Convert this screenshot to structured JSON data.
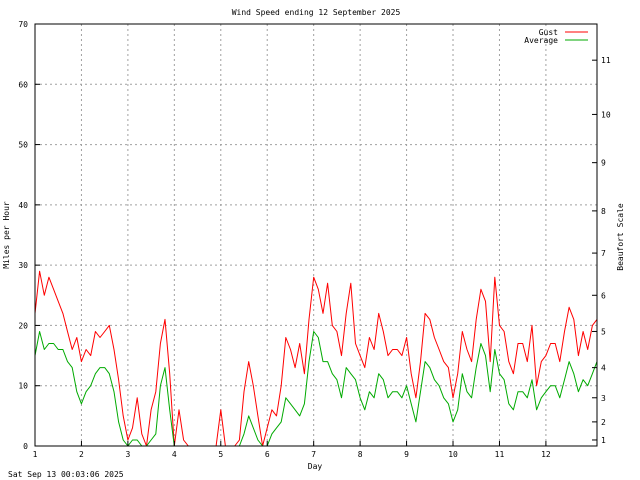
{
  "footer_timestamp": "Sat Sep 13 00:03:06 2025",
  "chart_data": {
    "type": "line",
    "title": "Wind Speed ending 12 September 2025",
    "xlabel": "Day",
    "ylabel": "Miles per Hour",
    "y2label": "Beaufort Scale",
    "xlim": [
      1,
      13.1
    ],
    "ylim": [
      0,
      70
    ],
    "x_ticks": [
      1,
      2,
      3,
      4,
      5,
      6,
      7,
      8,
      9,
      10,
      11,
      12
    ],
    "x_tick_labels": [
      "1",
      "2",
      "3",
      "4",
      "5",
      "6",
      "7",
      "8",
      "9",
      "10",
      "11",
      "12"
    ],
    "y_ticks": [
      0,
      10,
      20,
      30,
      40,
      50,
      60,
      70
    ],
    "y_tick_labels": [
      "0",
      "10",
      "20",
      "30",
      "40",
      "50",
      "60",
      "70"
    ],
    "y2_ticks": [
      1,
      2,
      3,
      4,
      5,
      6,
      7,
      8,
      9,
      10,
      11
    ],
    "y2_tick_labels": [
      "1",
      "2",
      "3",
      "4",
      "5",
      "6",
      "7",
      "8",
      "9",
      "10",
      "11"
    ],
    "y2_tick_mph": [
      1,
      4,
      8,
      13,
      19,
      25,
      32,
      39,
      47,
      55,
      64
    ],
    "grid": true,
    "legend_position": "top-right",
    "series": [
      {
        "name": "Gust",
        "color": "#ff0000",
        "x": [
          1.0,
          1.1,
          1.2,
          1.3,
          1.4,
          1.5,
          1.6,
          1.7,
          1.8,
          1.9,
          2.0,
          2.1,
          2.2,
          2.3,
          2.4,
          2.5,
          2.6,
          2.7,
          2.8,
          2.9,
          3.0,
          3.1,
          3.2,
          3.3,
          3.4,
          3.5,
          3.6,
          3.7,
          3.8,
          3.9,
          4.0,
          4.1,
          4.2,
          4.3,
          4.4,
          4.5,
          4.6,
          4.7,
          4.8,
          4.9,
          5.0,
          5.1,
          5.2,
          5.3,
          5.4,
          5.5,
          5.6,
          5.7,
          5.8,
          5.9,
          6.0,
          6.1,
          6.2,
          6.3,
          6.4,
          6.5,
          6.6,
          6.7,
          6.8,
          6.9,
          7.0,
          7.1,
          7.2,
          7.3,
          7.4,
          7.5,
          7.6,
          7.7,
          7.8,
          7.9,
          8.0,
          8.1,
          8.2,
          8.3,
          8.4,
          8.5,
          8.6,
          8.7,
          8.8,
          8.9,
          9.0,
          9.1,
          9.2,
          9.3,
          9.4,
          9.5,
          9.6,
          9.7,
          9.8,
          9.9,
          10.0,
          10.1,
          10.2,
          10.3,
          10.4,
          10.5,
          10.6,
          10.7,
          10.8,
          10.9,
          11.0,
          11.1,
          11.2,
          11.3,
          11.4,
          11.5,
          11.6,
          11.7,
          11.8,
          11.9,
          12.0,
          12.1,
          12.2,
          12.3,
          12.4,
          12.5,
          12.6,
          12.7,
          12.8,
          12.9,
          13.0,
          13.1
        ],
        "values": [
          22,
          29,
          25,
          28,
          26,
          24,
          22,
          19,
          16,
          18,
          14,
          16,
          15,
          19,
          18,
          19,
          20,
          16,
          11,
          5,
          1,
          3,
          8,
          2,
          0,
          6,
          9,
          17,
          21,
          12,
          0,
          6,
          1,
          0,
          0,
          0,
          0,
          0,
          0,
          0,
          6,
          0,
          0,
          0,
          1,
          9,
          14,
          10,
          5,
          0,
          3,
          6,
          5,
          10,
          18,
          16,
          13,
          17,
          12,
          21,
          28,
          26,
          22,
          27,
          20,
          19,
          15,
          22,
          27,
          17,
          15,
          13,
          18,
          16,
          22,
          19,
          15,
          16,
          16,
          15,
          18,
          12,
          8,
          14,
          22,
          21,
          18,
          16,
          14,
          13,
          8,
          12,
          19,
          16,
          14,
          21,
          26,
          24,
          14,
          28,
          20,
          19,
          14,
          12,
          17,
          17,
          14,
          20,
          10,
          14,
          15,
          17,
          17,
          14,
          19,
          23,
          21,
          15,
          19,
          16,
          20,
          21
        ]
      },
      {
        "name": "Average",
        "color": "#00aa00",
        "x": [
          1.0,
          1.1,
          1.2,
          1.3,
          1.4,
          1.5,
          1.6,
          1.7,
          1.8,
          1.9,
          2.0,
          2.1,
          2.2,
          2.3,
          2.4,
          2.5,
          2.6,
          2.7,
          2.8,
          2.9,
          3.0,
          3.1,
          3.2,
          3.3,
          3.4,
          3.5,
          3.6,
          3.7,
          3.8,
          3.9,
          4.0,
          4.1,
          4.2,
          4.3,
          4.4,
          4.5,
          4.6,
          4.7,
          4.8,
          4.9,
          5.0,
          5.1,
          5.2,
          5.3,
          5.4,
          5.5,
          5.6,
          5.7,
          5.8,
          5.9,
          6.0,
          6.1,
          6.2,
          6.3,
          6.4,
          6.5,
          6.6,
          6.7,
          6.8,
          6.9,
          7.0,
          7.1,
          7.2,
          7.3,
          7.4,
          7.5,
          7.6,
          7.7,
          7.8,
          7.9,
          8.0,
          8.1,
          8.2,
          8.3,
          8.4,
          8.5,
          8.6,
          8.7,
          8.8,
          8.9,
          9.0,
          9.1,
          9.2,
          9.3,
          9.4,
          9.5,
          9.6,
          9.7,
          9.8,
          9.9,
          10.0,
          10.1,
          10.2,
          10.3,
          10.4,
          10.5,
          10.6,
          10.7,
          10.8,
          10.9,
          11.0,
          11.1,
          11.2,
          11.3,
          11.4,
          11.5,
          11.6,
          11.7,
          11.8,
          11.9,
          12.0,
          12.1,
          12.2,
          12.3,
          12.4,
          12.5,
          12.6,
          12.7,
          12.8,
          12.9,
          13.0,
          13.1
        ],
        "values": [
          15,
          19,
          16,
          17,
          17,
          16,
          16,
          14,
          13,
          9,
          7,
          9,
          10,
          12,
          13,
          13,
          12,
          9,
          4,
          1,
          0,
          1,
          1,
          0,
          0,
          1,
          2,
          10,
          13,
          6,
          0,
          0,
          0,
          0,
          0,
          0,
          0,
          0,
          0,
          0,
          0,
          0,
          0,
          0,
          0,
          2,
          5,
          3,
          1,
          0,
          0,
          2,
          3,
          4,
          8,
          7,
          6,
          5,
          7,
          14,
          19,
          18,
          14,
          14,
          12,
          11,
          8,
          13,
          12,
          11,
          8,
          6,
          9,
          8,
          12,
          11,
          8,
          9,
          9,
          8,
          10,
          7,
          4,
          9,
          14,
          13,
          11,
          10,
          8,
          7,
          4,
          6,
          12,
          9,
          8,
          13,
          17,
          15,
          9,
          16,
          12,
          11,
          7,
          6,
          9,
          9,
          8,
          11,
          6,
          8,
          9,
          10,
          10,
          8,
          11,
          14,
          12,
          9,
          11,
          10,
          12,
          14
        ]
      }
    ]
  }
}
